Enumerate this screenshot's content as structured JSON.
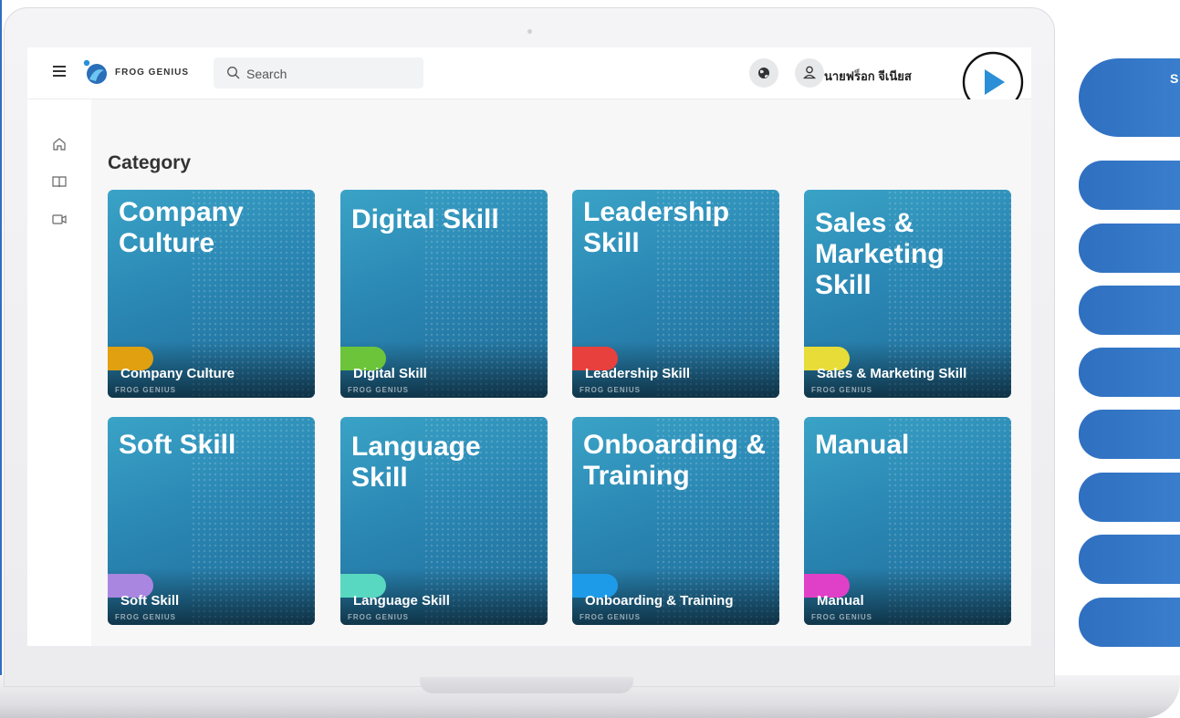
{
  "app": {
    "brand": "FROG GENIUS"
  },
  "search": {
    "placeholder": "Search"
  },
  "header": {
    "user_name": "นายฟร็อก จีเนียส"
  },
  "main": {
    "section_title": "Category",
    "categories": [
      {
        "headline": "Company Culture",
        "label": "Company Culture",
        "tag_color": "#e0a010",
        "watermark": "FROG GENIUS"
      },
      {
        "headline": "Digital Skill",
        "label": "Digital Skill",
        "tag_color": "#6cc43a",
        "watermark": "FROG GENIUS"
      },
      {
        "headline": "Leadership Skill",
        "label": "Leadership Skill",
        "tag_color": "#e8403c",
        "watermark": "FROG GENIUS"
      },
      {
        "headline": "Sales & Marketing Skill",
        "label": "Sales & Marketing Skill",
        "tag_color": "#e8dc38",
        "watermark": "FROG GENIUS"
      },
      {
        "headline": "Soft Skill",
        "label": "Soft Skill",
        "tag_color": "#a986e0",
        "watermark": "FROG GENIUS"
      },
      {
        "headline": "Language Skill",
        "label": "Language Skill",
        "tag_color": "#58d8c0",
        "watermark": "FROG GENIUS"
      },
      {
        "headline": "Onboarding & Training",
        "label": "Onboarding & Training",
        "tag_color": "#1e9be8",
        "watermark": "FROG GENIUS"
      },
      {
        "headline": "Manual",
        "label": "Manual",
        "tag_color": "#e040c8",
        "watermark": "FROG GENIUS"
      }
    ]
  },
  "side_panel": {
    "first_label": "S"
  },
  "colors": {
    "accent": "#2f6fc0",
    "play": "#2a8fd6"
  }
}
